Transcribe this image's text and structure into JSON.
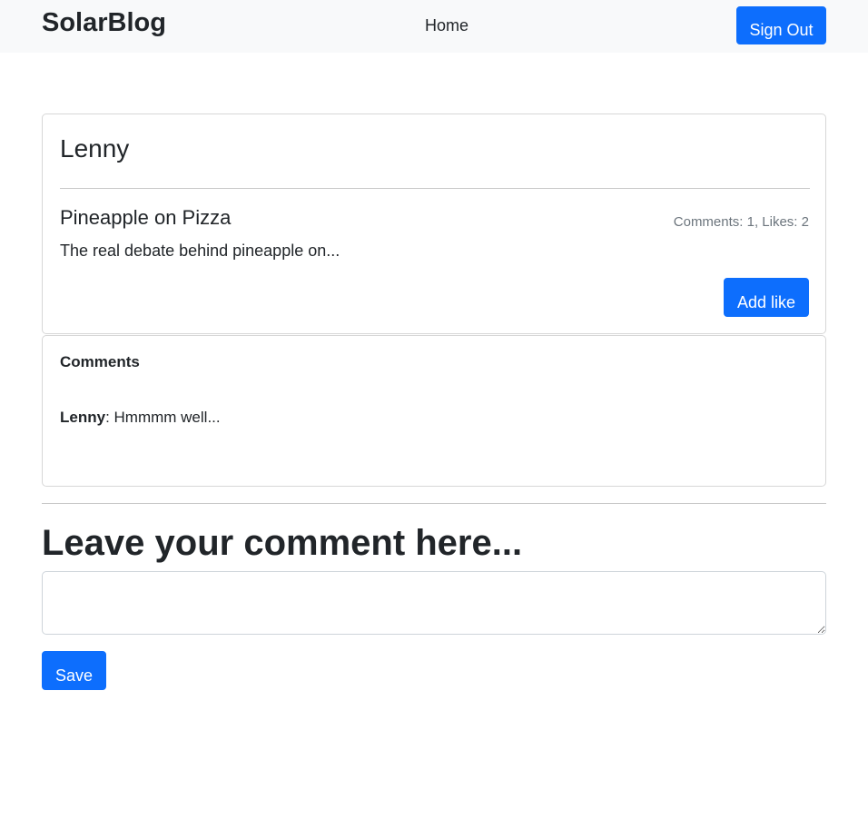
{
  "navbar": {
    "brand": "SolarBlog",
    "links": [
      {
        "label": "Home"
      }
    ],
    "sign_out_label": "Sign Out",
    "background": "#f8f9fa"
  },
  "post": {
    "author": "Lenny",
    "title": "Pineapple on Pizza",
    "stats": "Comments: 1, Likes: 2",
    "excerpt": "The real debate behind pineapple on...",
    "like_button_label": "Add like"
  },
  "comments": {
    "title": "Comments",
    "items": [
      {
        "author": "Lenny",
        "separator": ": ",
        "text": "Hmmmm well..."
      }
    ]
  },
  "comment_form": {
    "heading": "Leave your comment here...",
    "textarea_value": "",
    "save_label": "Save"
  },
  "colors": {
    "primary": "#0d6efd",
    "muted": "#6c757d",
    "text": "#212529"
  }
}
